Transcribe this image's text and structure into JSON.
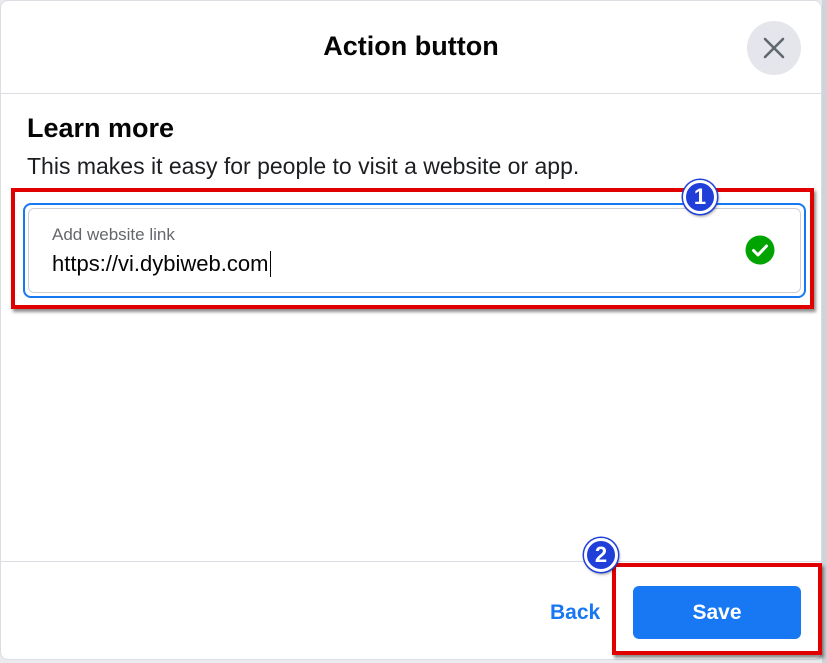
{
  "dialog": {
    "title": "Action button",
    "close_icon": "close-icon"
  },
  "section": {
    "title": "Learn more",
    "description": "This makes it easy for people to visit a website or app."
  },
  "website_field": {
    "label": "Add website link",
    "value": "https://vi.dybiweb.com",
    "status_icon": "check-circle-icon",
    "status_color": "#00a400"
  },
  "annotations": {
    "step1": "1",
    "step2": "2",
    "highlight_color": "#e00000",
    "badge_color": "#1f3fd8"
  },
  "footer": {
    "back_label": "Back",
    "save_label": "Save"
  },
  "colors": {
    "accent": "#1877f2"
  }
}
